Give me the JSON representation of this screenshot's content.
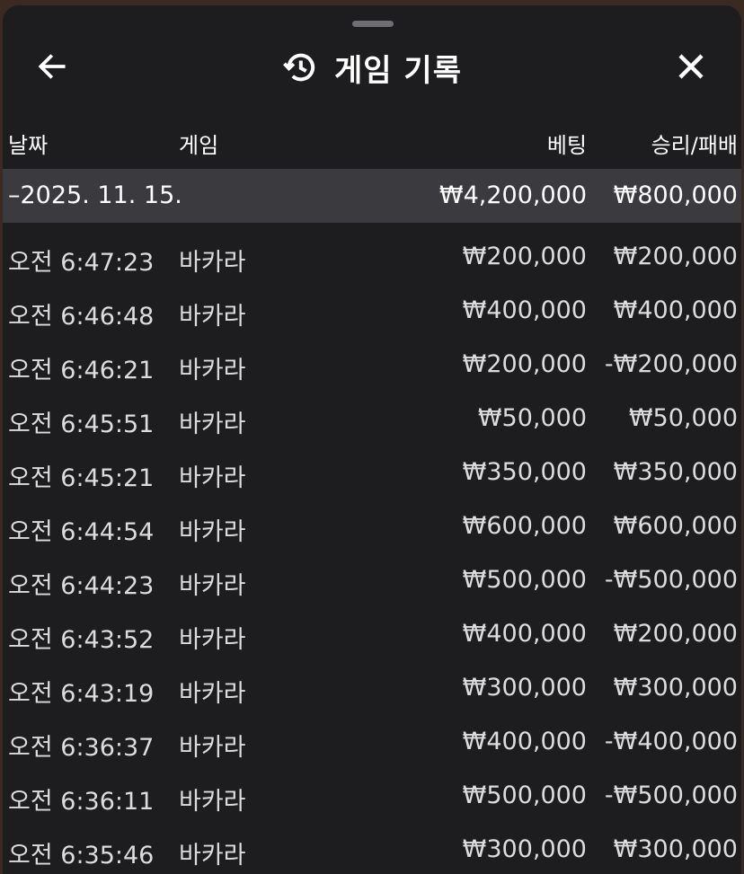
{
  "header": {
    "title": "게임 기록",
    "back_icon": "arrow-left-icon",
    "history_icon": "history-icon",
    "close_icon": "close-icon"
  },
  "columns": {
    "date": "날짜",
    "game": "게임",
    "bet": "베팅",
    "result": "승리/패배"
  },
  "group": {
    "date": "–2025. 11. 15.",
    "bet_total": "₩4,200,000",
    "result_total": "₩800,000"
  },
  "rows": [
    {
      "time": "오전 6:47:23",
      "game": "바카라",
      "bet": "₩200,000",
      "result": "₩200,000"
    },
    {
      "time": "오전 6:46:48",
      "game": "바카라",
      "bet": "₩400,000",
      "result": "₩400,000"
    },
    {
      "time": "오전 6:46:21",
      "game": "바카라",
      "bet": "₩200,000",
      "result": "-₩200,000"
    },
    {
      "time": "오전 6:45:51",
      "game": "바카라",
      "bet": "₩50,000",
      "result": "₩50,000"
    },
    {
      "time": "오전 6:45:21",
      "game": "바카라",
      "bet": "₩350,000",
      "result": "₩350,000"
    },
    {
      "time": "오전 6:44:54",
      "game": "바카라",
      "bet": "₩600,000",
      "result": "₩600,000"
    },
    {
      "time": "오전 6:44:23",
      "game": "바카라",
      "bet": "₩500,000",
      "result": "-₩500,000"
    },
    {
      "time": "오전 6:43:52",
      "game": "바카라",
      "bet": "₩400,000",
      "result": "₩200,000"
    },
    {
      "time": "오전 6:43:19",
      "game": "바카라",
      "bet": "₩300,000",
      "result": "₩300,000"
    },
    {
      "time": "오전 6:36:37",
      "game": "바카라",
      "bet": "₩400,000",
      "result": "-₩400,000"
    },
    {
      "time": "오전 6:36:11",
      "game": "바카라",
      "bet": "₩500,000",
      "result": "-₩500,000"
    },
    {
      "time": "오전 6:35:46",
      "game": "바카라",
      "bet": "₩300,000",
      "result": "₩300,000"
    }
  ]
}
